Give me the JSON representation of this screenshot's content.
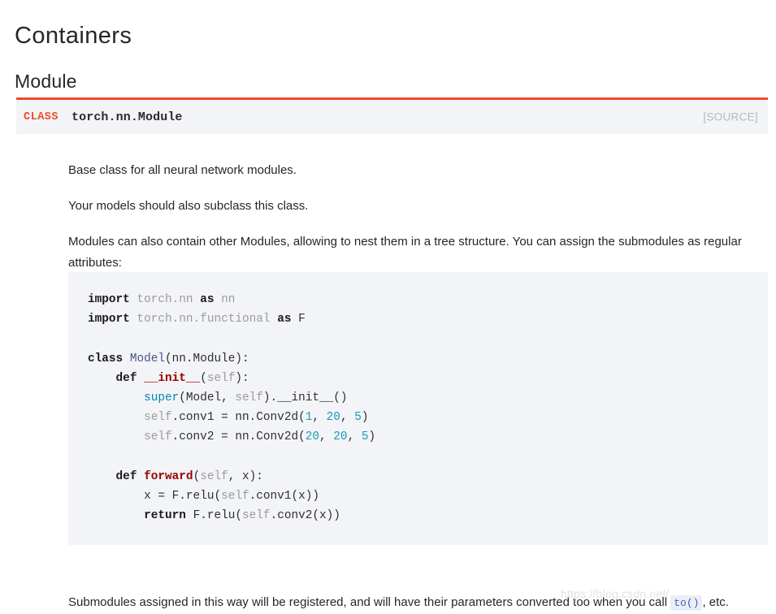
{
  "headings": {
    "section": "Containers",
    "subsection": "Module"
  },
  "signature": {
    "kind_label": "CLASS",
    "qualified_name": "torch.nn.Module",
    "source_link": "[SOURCE]"
  },
  "paragraphs": {
    "p1": "Base class for all neural network modules.",
    "p2": "Your models should also subclass this class.",
    "p3": "Modules can also contain other Modules, allowing to nest them in a tree structure. You can assign the submodules as regular attributes:",
    "p4_before": "Submodules assigned in this way will be registered, and will have their parameters converted too when you call ",
    "p4_code": "to()",
    "p4_after": ", etc."
  },
  "code_block": {
    "language": "python",
    "lines": [
      [
        {
          "t": "import",
          "c": "k"
        },
        {
          "t": " ",
          "c": "pl"
        },
        {
          "t": "torch.nn",
          "c": "nn"
        },
        {
          "t": " ",
          "c": "pl"
        },
        {
          "t": "as",
          "c": "k"
        },
        {
          "t": " ",
          "c": "pl"
        },
        {
          "t": "nn",
          "c": "nn"
        }
      ],
      [
        {
          "t": "import",
          "c": "k"
        },
        {
          "t": " ",
          "c": "pl"
        },
        {
          "t": "torch.nn.functional",
          "c": "nn"
        },
        {
          "t": " ",
          "c": "pl"
        },
        {
          "t": "as",
          "c": "k"
        },
        {
          "t": " ",
          "c": "pl"
        },
        {
          "t": "F",
          "c": "pl"
        }
      ],
      [],
      [
        {
          "t": "class",
          "c": "k"
        },
        {
          "t": " ",
          "c": "pl"
        },
        {
          "t": "Model",
          "c": "cls"
        },
        {
          "t": "(nn.Module):",
          "c": "pl"
        }
      ],
      [
        {
          "t": "    ",
          "c": "pl"
        },
        {
          "t": "def",
          "c": "k"
        },
        {
          "t": " ",
          "c": "pl"
        },
        {
          "t": "__init__",
          "c": "fn"
        },
        {
          "t": "(",
          "c": "pl"
        },
        {
          "t": "self",
          "c": "nn"
        },
        {
          "t": "):",
          "c": "pl"
        }
      ],
      [
        {
          "t": "        ",
          "c": "pl"
        },
        {
          "t": "super",
          "c": "bi"
        },
        {
          "t": "(Model, ",
          "c": "pl"
        },
        {
          "t": "self",
          "c": "nn"
        },
        {
          "t": ").__init__()",
          "c": "pl"
        }
      ],
      [
        {
          "t": "        ",
          "c": "pl"
        },
        {
          "t": "self",
          "c": "nn"
        },
        {
          "t": ".conv1 = nn.Conv2d(",
          "c": "pl"
        },
        {
          "t": "1",
          "c": "num"
        },
        {
          "t": ", ",
          "c": "pl"
        },
        {
          "t": "20",
          "c": "num"
        },
        {
          "t": ", ",
          "c": "pl"
        },
        {
          "t": "5",
          "c": "num"
        },
        {
          "t": ")",
          "c": "pl"
        }
      ],
      [
        {
          "t": "        ",
          "c": "pl"
        },
        {
          "t": "self",
          "c": "nn"
        },
        {
          "t": ".conv2 = nn.Conv2d(",
          "c": "pl"
        },
        {
          "t": "20",
          "c": "num"
        },
        {
          "t": ", ",
          "c": "pl"
        },
        {
          "t": "20",
          "c": "num"
        },
        {
          "t": ", ",
          "c": "pl"
        },
        {
          "t": "5",
          "c": "num"
        },
        {
          "t": ")",
          "c": "pl"
        }
      ],
      [],
      [
        {
          "t": "    ",
          "c": "pl"
        },
        {
          "t": "def",
          "c": "k"
        },
        {
          "t": " ",
          "c": "pl"
        },
        {
          "t": "forward",
          "c": "fn"
        },
        {
          "t": "(",
          "c": "pl"
        },
        {
          "t": "self",
          "c": "nn"
        },
        {
          "t": ", x):",
          "c": "pl"
        }
      ],
      [
        {
          "t": "        ",
          "c": "pl"
        },
        {
          "t": "x = F.relu(",
          "c": "pl"
        },
        {
          "t": "self",
          "c": "nn"
        },
        {
          "t": ".conv1(x))",
          "c": "pl"
        }
      ],
      [
        {
          "t": "        ",
          "c": "pl"
        },
        {
          "t": "return",
          "c": "k"
        },
        {
          "t": " ",
          "c": "pl"
        },
        {
          "t": "F.relu(",
          "c": "pl"
        },
        {
          "t": "self",
          "c": "nn"
        },
        {
          "t": ".conv2(x))",
          "c": "pl"
        }
      ]
    ]
  },
  "watermark": {
    "text": "https://blog.csdn.net/"
  },
  "colors": {
    "accent_orange": "#ee4c2c",
    "code_background": "#f3f4f7",
    "body_text": "#262626",
    "source_link": "#b4b8c0",
    "code_number": "#199bb5",
    "code_function": "#990000",
    "code_class": "#445588",
    "code_builtin": "#0086b3",
    "code_muted": "#9b9b9b"
  }
}
